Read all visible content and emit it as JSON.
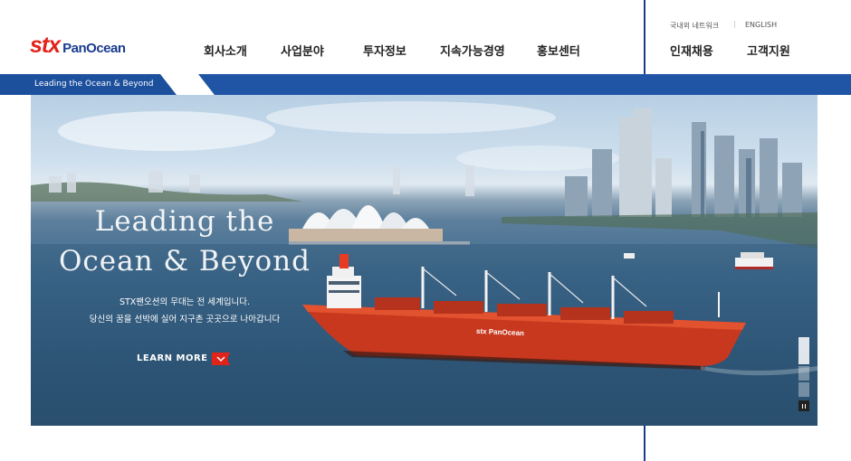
{
  "brand": {
    "logo_main": "stx",
    "logo_sub": "PanOcean",
    "color_red": "#e2231a",
    "color_navy": "#1a3c8f"
  },
  "nav": {
    "items": [
      {
        "label": "회사소개"
      },
      {
        "label": "사업분야"
      },
      {
        "label": "투자정보"
      },
      {
        "label": "지속가능경영"
      },
      {
        "label": "홍보센터"
      }
    ]
  },
  "util": {
    "network": "국내외 네트워크",
    "english": "ENGLISH",
    "recruit": "인재채용",
    "support": "고객지원"
  },
  "tagline": "Leading the Ocean & Beyond",
  "hero": {
    "title_line1": "Leading the",
    "title_line2": "Ocean & Beyond",
    "desc_line1": "STX팬오션의 무대는 전 세계입니다.",
    "desc_line2": "당신의 꿈을 선박에 실어 지구촌 곳곳으로 나아갑니다",
    "learn_more": "LEARN MORE",
    "ship_logo": "stx PanOcean"
  },
  "slider": {
    "active_index": 0,
    "count": 3,
    "pause_icon": "pause-icon"
  },
  "icons": [
    "arrow-down-icon",
    "pause-icon"
  ],
  "colors": {
    "strip_blue": "#1f55a4",
    "divider": "#1a3c8f"
  }
}
